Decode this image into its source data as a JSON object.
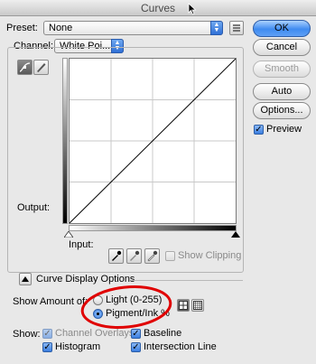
{
  "window": {
    "title": "Curves"
  },
  "preset": {
    "label": "Preset:",
    "value": "None"
  },
  "channel": {
    "label": "Channel:",
    "value": "White Poi..."
  },
  "buttons": {
    "ok": "OK",
    "cancel": "Cancel",
    "smooth": "Smooth",
    "auto": "Auto",
    "options": "Options..."
  },
  "preview": {
    "label": "Preview",
    "checked": true
  },
  "graph": {
    "output_label": "Output:",
    "input_label": "Input:"
  },
  "show_clipping": {
    "label": "Show Clipping",
    "checked": false
  },
  "display_options": {
    "section_label": "Curve Display Options",
    "show_amount_label": "Show Amount of:",
    "light_label": "Light  (0-255)",
    "pigment_label": "Pigment/Ink %",
    "selected": "pigment",
    "show_label": "Show:",
    "channel_overlays": "Channel Overlays",
    "baseline": "Baseline",
    "histogram": "Histogram",
    "intersection_line": "Intersection Line"
  },
  "colors": {
    "accent": "#3b7ee0",
    "highlight_ring": "#e00000"
  }
}
